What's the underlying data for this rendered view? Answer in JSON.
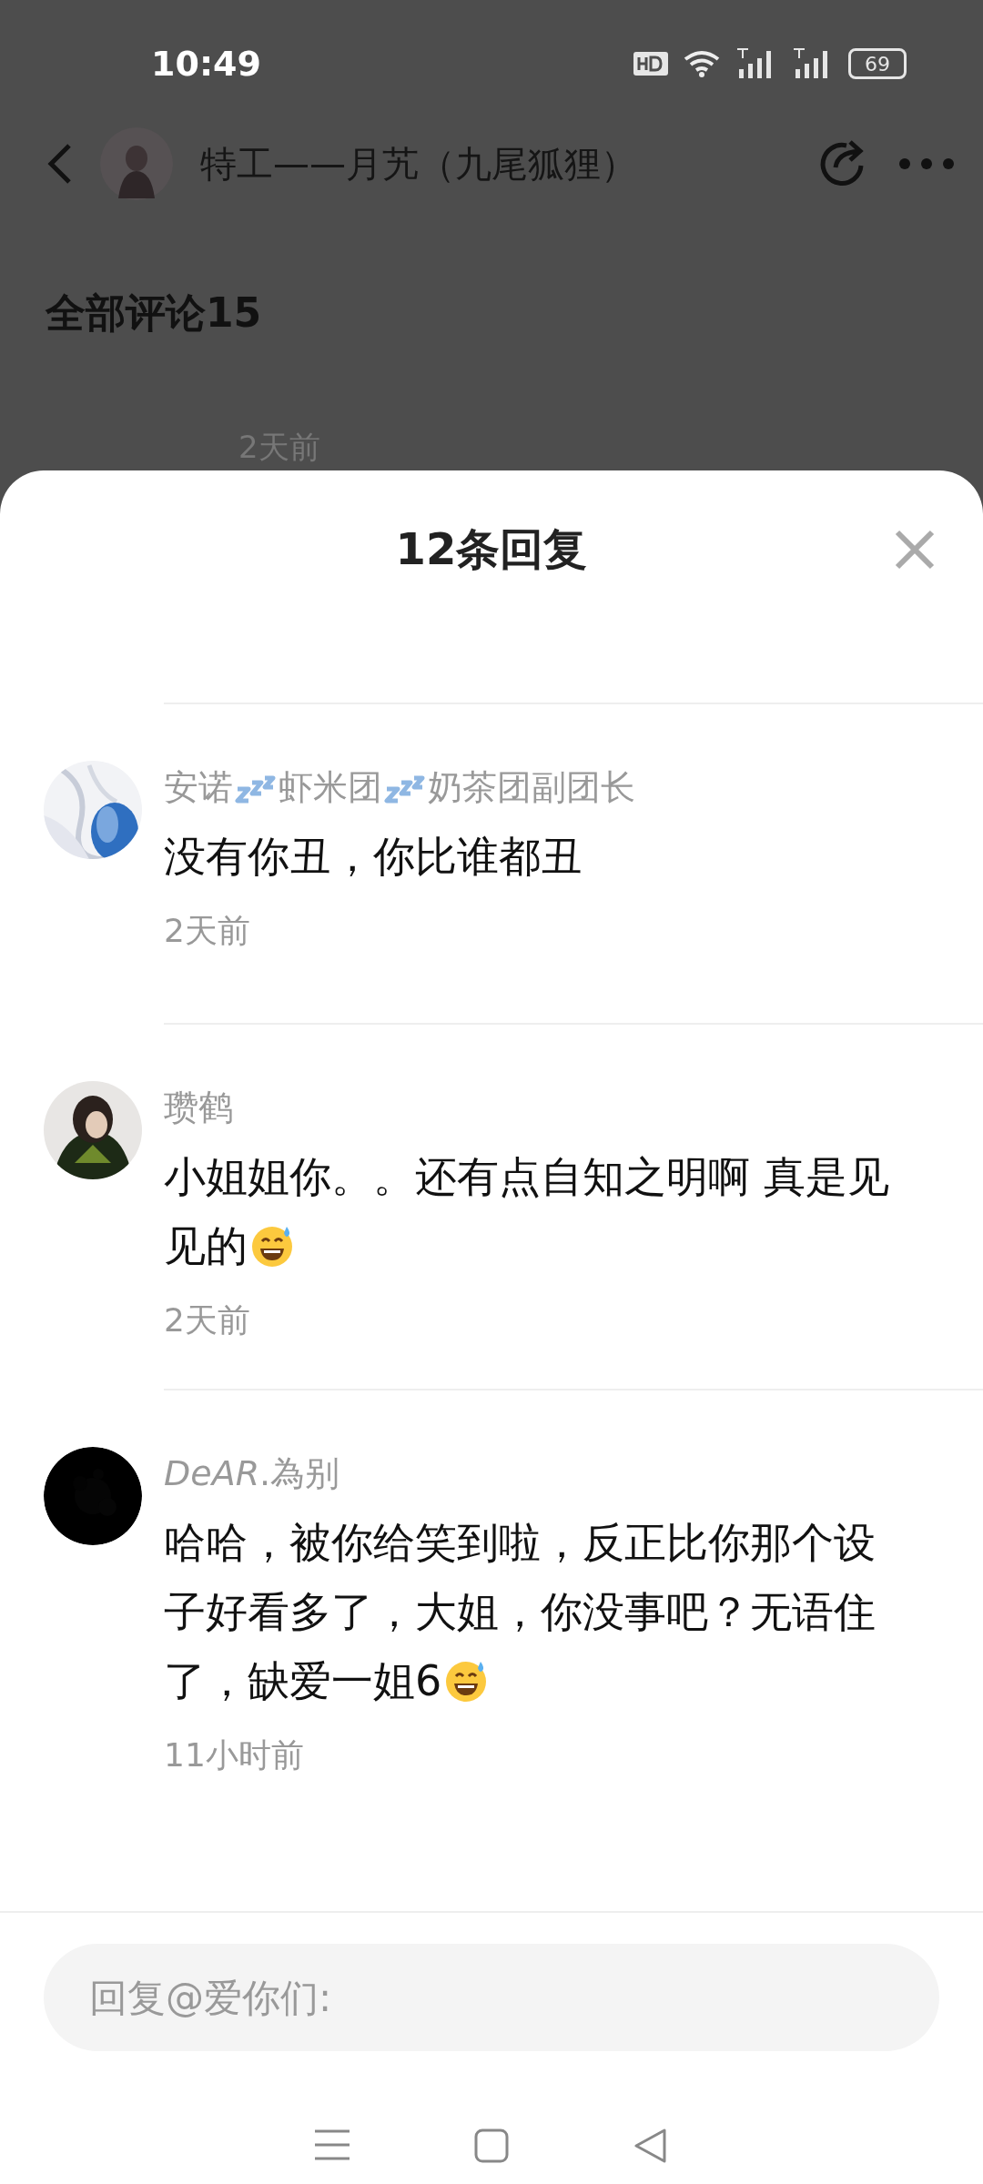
{
  "status_bar": {
    "time": "10:49",
    "battery": "69"
  },
  "header": {
    "title": "特工——月艽（九尾狐狸）"
  },
  "section_title": "全部评论15",
  "background_time": "2天前",
  "sheet": {
    "title": "12条回复"
  },
  "replies": [
    {
      "name_parts": [
        "安诺",
        "虾米团",
        "奶茶团副团长"
      ],
      "text_lines": [
        "没有你丑，你比谁都丑"
      ],
      "emoji": false,
      "time": "2天前"
    },
    {
      "name_parts": [
        "瓒鹤"
      ],
      "text_lines": [
        "小姐姐你。。还有点自知之明啊 真是见",
        "见的"
      ],
      "emoji": true,
      "time": "2天前"
    },
    {
      "name_parts": [
        "*DeAR*.為别"
      ],
      "text_lines": [
        "哈哈，被你给笑到啦，反正比你那个设",
        "子好看多了，大姐，你没事吧？无语住",
        "了，缺爱一姐6"
      ],
      "emoji": true,
      "time": "11小时前"
    }
  ],
  "reply_field": {
    "placeholder": "回复@爱你们:"
  }
}
